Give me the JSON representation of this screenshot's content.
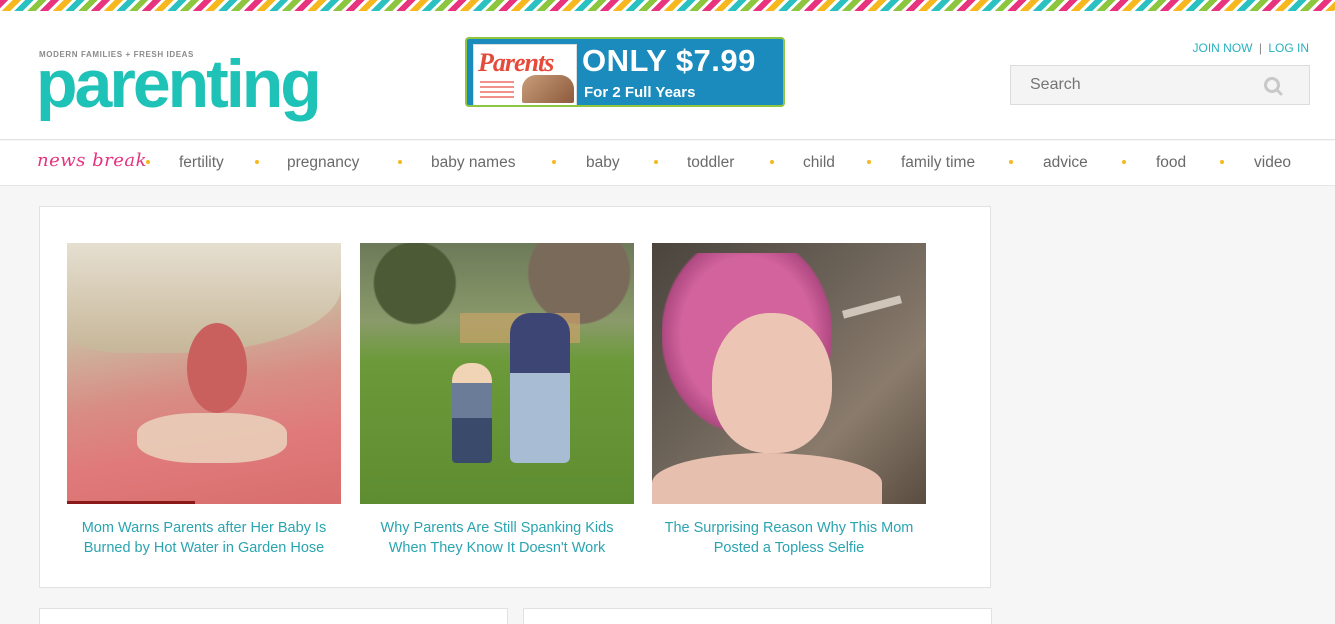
{
  "logo": {
    "tagline": "MODERN FAMILIES + FRESH IDEAS",
    "word": "parenting"
  },
  "promo": {
    "cover_title": "Parents",
    "price": "ONLY $7.99",
    "sub": "For 2 Full Years"
  },
  "auth": {
    "join": "JOIN NOW",
    "separator": "|",
    "login": "LOG IN"
  },
  "search": {
    "placeholder": "Search",
    "icon": "search-icon"
  },
  "nav": {
    "newsbreak": "news break",
    "items": [
      "fertility",
      "pregnancy",
      "baby names",
      "baby",
      "toddler",
      "child",
      "family time",
      "advice",
      "food",
      "video"
    ]
  },
  "articles": [
    {
      "title": "Mom Warns Parents after Her Baby Is Burned by Hot Water in Garden Hose"
    },
    {
      "title": "Why Parents Are Still Spanking Kids When They Know It Doesn't Work"
    },
    {
      "title": "The Surprising Reason Why This Mom Posted a Topless Selfie"
    }
  ],
  "colors": {
    "brand": "#1fc2b6",
    "accent": "#e4337f",
    "link": "#2aa4b0",
    "dot": "#f6b81e",
    "promo_bg": "#1b8bbd",
    "promo_border": "#8ec63f"
  }
}
